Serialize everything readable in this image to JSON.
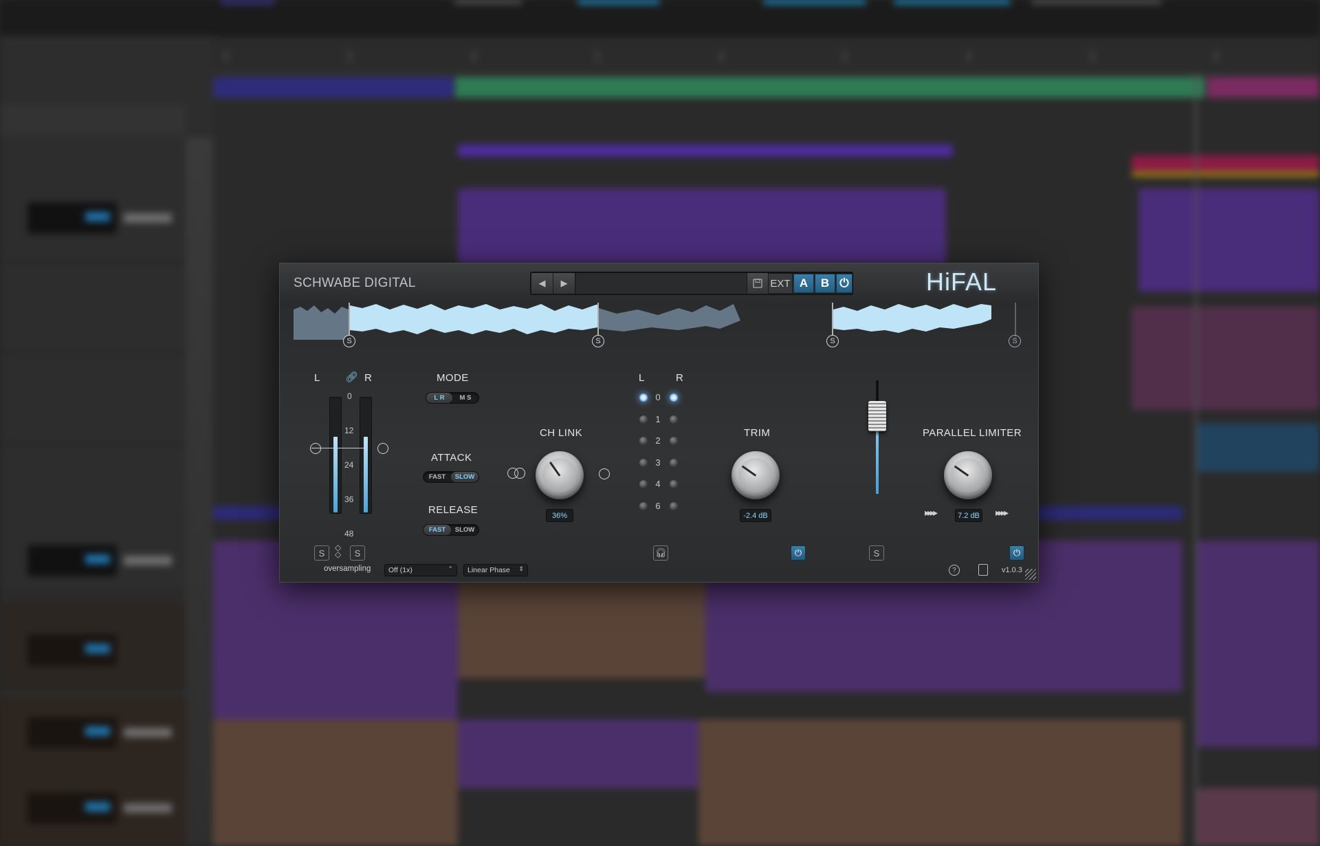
{
  "plugin": {
    "brand": "SCHWABE DIGITAL",
    "logo": "HiFAL",
    "version": "v1.0.3",
    "preset": {
      "prev_icon": "triangle-left",
      "next_icon": "triangle-right",
      "name": "",
      "save_icon": "floppy-disk",
      "ext_label": "EXT",
      "a_label": "A",
      "b_label": "B",
      "power_icon": "power"
    },
    "waveform": {
      "split_marker_label": "S",
      "colors": {
        "active": "#bfe3f7",
        "inactive": "#6b7f91"
      }
    },
    "input": {
      "left_label": "L",
      "right_label": "R",
      "link_icon": "link",
      "scale": [
        "0",
        "12",
        "24",
        "36",
        "48"
      ],
      "solo_left": "S",
      "solo_right": "S"
    },
    "mode": {
      "label": "MODE",
      "options": [
        "L R",
        "M S"
      ],
      "selected": "L R"
    },
    "attack": {
      "label": "ATTACK",
      "options": [
        "FAST",
        "SLOW"
      ],
      "selected": "SLOW"
    },
    "release": {
      "label": "RELEASE",
      "options": [
        "FAST",
        "SLOW"
      ],
      "selected": "FAST"
    },
    "ch_link": {
      "label": "CH LINK",
      "value": "36%"
    },
    "meters": {
      "left_label": "L",
      "right_label": "R",
      "scale": [
        "0",
        "1",
        "2",
        "3",
        "4",
        "6"
      ],
      "lit": [
        "0"
      ],
      "headphone_icon": "headphones"
    },
    "trim": {
      "label": "TRIM",
      "value": "-2.4 dB"
    },
    "fader": {
      "solo_label": "S",
      "level": 0.64
    },
    "parallel_limiter": {
      "label": "PARALLEL LIMITER",
      "value": "7.2 dB"
    },
    "footer": {
      "oversampling_label": "oversampling",
      "oversampling_value": "Off (1x)",
      "phase_value": "Linear Phase",
      "help_icon": "question",
      "manual_icon": "document"
    },
    "accent": "#7ed0f5"
  }
}
